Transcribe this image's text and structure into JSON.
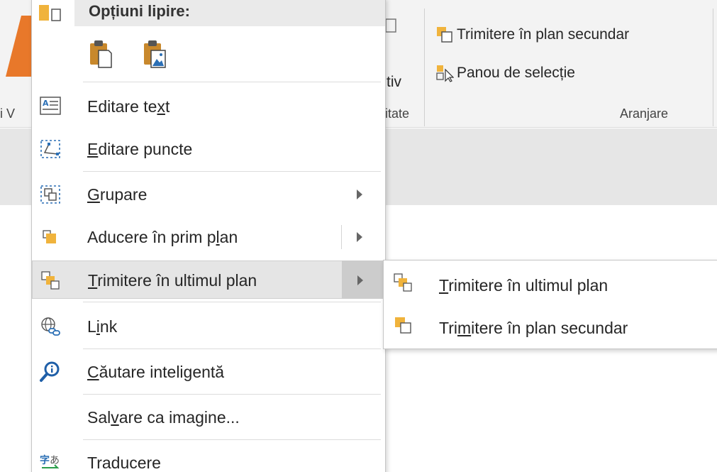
{
  "ribbon": {
    "partial_left_label": "i V",
    "partial_tiv": "tiv",
    "partial_itate": "itate",
    "send_backward": "Trimitere în plan secundar",
    "selection_pane": "Panou de selecție",
    "group_label": "Aranjare"
  },
  "menu": {
    "header": "Opțiuni lipire:",
    "paste_options": [
      "paste-icon",
      "paste-picture-icon"
    ],
    "items": [
      {
        "name": "edit-text",
        "icon": "edit-text-icon",
        "pre": "Editare te",
        "ul": "x",
        "post": "t",
        "submenu": false
      },
      {
        "name": "edit-points",
        "icon": "edit-points-icon",
        "pre": "",
        "ul": "E",
        "post": "ditare puncte",
        "submenu": false
      },
      {
        "name": "group",
        "icon": "group-icon",
        "pre": "",
        "ul": "G",
        "post": "rupare",
        "submenu": true
      },
      {
        "name": "bring-to-front",
        "icon": "bring-forward-icon",
        "pre": "Aducere în prim p",
        "ul": "l",
        "post": "an",
        "submenu": true
      },
      {
        "name": "send-to-back",
        "icon": "send-to-back-icon",
        "pre": "",
        "ul": "T",
        "post": "rimitere în ultimul plan",
        "submenu": true
      },
      {
        "name": "link",
        "icon": "link-icon",
        "pre": "L",
        "ul": "i",
        "post": "nk",
        "submenu": false
      },
      {
        "name": "smart-lookup",
        "icon": "smart-lookup-icon",
        "pre": "",
        "ul": "C",
        "post": "ăutare inteligentă",
        "submenu": false
      },
      {
        "name": "save-as-picture",
        "icon": "",
        "pre": "Sal",
        "ul": "v",
        "post": "are ca imagine...",
        "submenu": false
      },
      {
        "name": "translate",
        "icon": "translate-icon",
        "pre": "",
        "ul": "",
        "post": "Traducere",
        "submenu": false
      }
    ]
  },
  "submenu": {
    "items": [
      {
        "icon": "send-to-back-icon",
        "pre": "",
        "ul": "T",
        "post": "rimitere în ultimul plan"
      },
      {
        "icon": "send-backward-icon",
        "pre": "Tri",
        "ul": "m",
        "post": "itere în plan secundar"
      }
    ]
  },
  "colors": {
    "accent_orange": "#f0a830",
    "highlight": "#e5e5e5",
    "icon_blue": "#2b6fb5"
  }
}
